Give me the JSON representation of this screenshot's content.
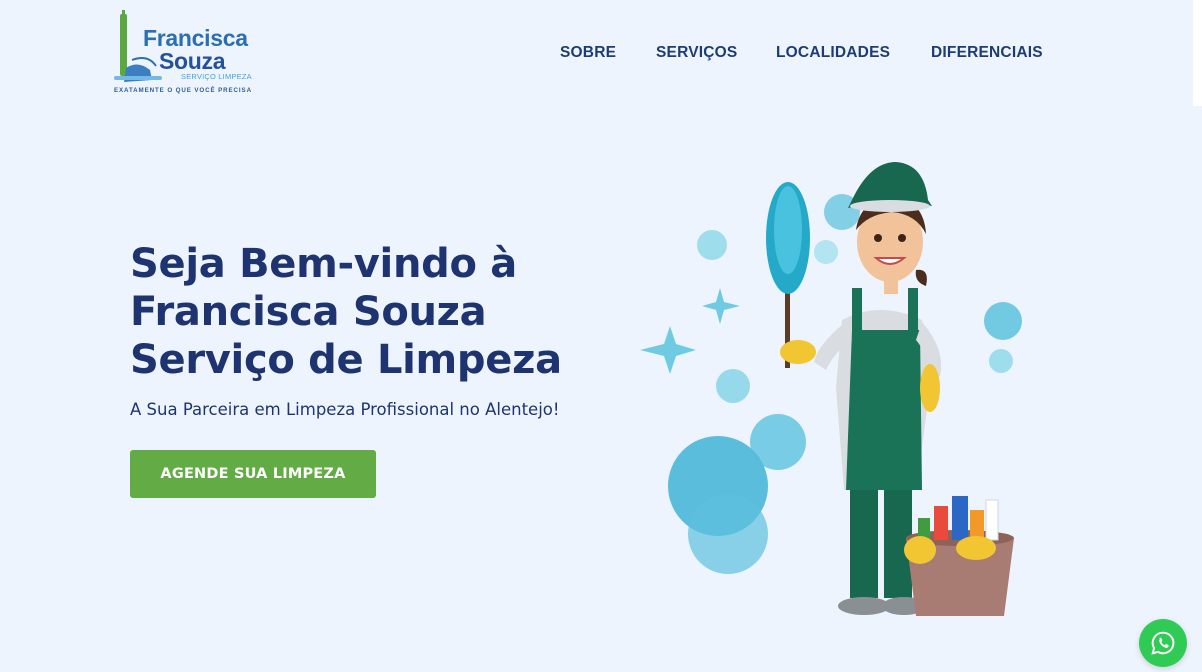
{
  "header": {
    "logo": {
      "line1": "Francisca",
      "line2": "Souza",
      "sub": "SERVIÇO LIMPEZA",
      "tagline": "EXATAMENTE O QUE VOCÊ PRECISA"
    },
    "nav": [
      {
        "label": "SOBRE"
      },
      {
        "label": "SERVIÇOS"
      },
      {
        "label": "LOCALIDADES"
      },
      {
        "label": "DIFERENCIAIS"
      }
    ]
  },
  "hero": {
    "title_lines": [
      "Seja Bem-vindo à",
      "Francisca Souza",
      "Serviço de Limpeza"
    ],
    "subtitle": "A Sua Parceira em Limpeza Profissional no Alentejo!",
    "cta_label": "AGENDE SUA LIMPEZA"
  },
  "floating": {
    "whatsapp_icon": "whatsapp-icon"
  },
  "colors": {
    "background": "#eef4fd",
    "heading": "#1e3470",
    "cta": "#62ab45",
    "whatsapp": "#2fcb55",
    "bubble": "#4fbfdc"
  }
}
